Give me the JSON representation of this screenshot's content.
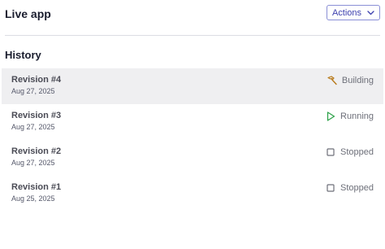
{
  "header": {
    "title": "Live app",
    "actions_label": "Actions"
  },
  "history": {
    "title": "History",
    "revisions": [
      {
        "name": "Revision #4",
        "date": "Aug 27, 2025",
        "status": "Building",
        "status_icon": "hammer-icon",
        "status_color": "#b87a1a",
        "selected": true
      },
      {
        "name": "Revision #3",
        "date": "Aug 27, 2025",
        "status": "Running",
        "status_icon": "play-icon",
        "status_color": "#2ea24a",
        "selected": false
      },
      {
        "name": "Revision #2",
        "date": "Aug 27, 2025",
        "status": "Stopped",
        "status_icon": "stop-square-icon",
        "status_color": "#6d6f79",
        "selected": false
      },
      {
        "name": "Revision #1",
        "date": "Aug 25, 2025",
        "status": "Stopped",
        "status_icon": "stop-square-icon",
        "status_color": "#6d6f79",
        "selected": false
      }
    ]
  },
  "colors": {
    "accent": "#3c3fae",
    "selected_row_bg": "#efeff1"
  }
}
